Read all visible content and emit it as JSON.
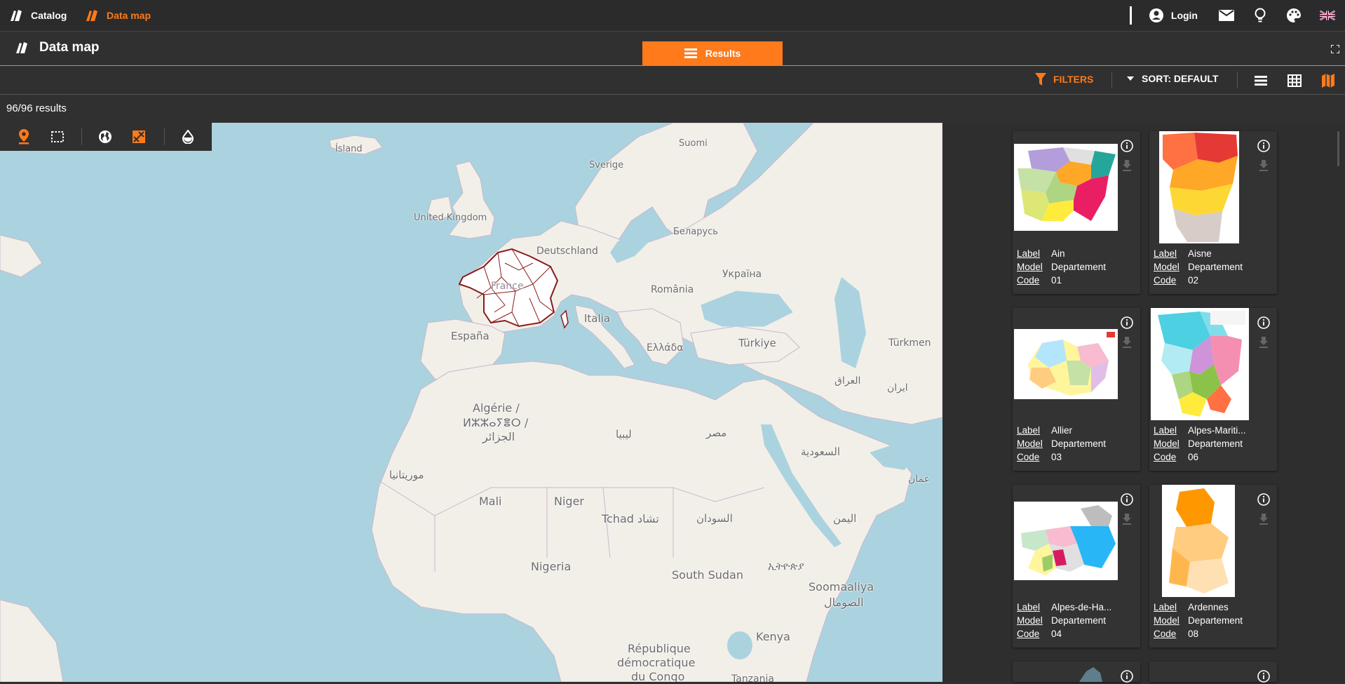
{
  "topbar": {
    "catalog_label": "Catalog",
    "datamap_label": "Data map",
    "login_label": "Login"
  },
  "header": {
    "page_title": "Data map",
    "results_tab_label": "Results"
  },
  "toolbar": {
    "filters_label": "FILTERS",
    "sort_label": "SORT: DEFAULT"
  },
  "results_count": "96/96 results",
  "colors": {
    "accent": "#ff7a1a",
    "background": "#303030",
    "sea": "#aad3df",
    "land": "#f2efe9"
  },
  "map": {
    "labels": [
      "Ísland",
      "Suomi",
      "Sverige",
      "United Kingdom",
      "Беларусь",
      "Deutschland",
      "Україна",
      "France",
      "România",
      "Italia",
      "España",
      "Türkiye",
      "Ελλάδα",
      "Türkmen",
      "العراق",
      "ایران",
      "Algérie /",
      "ⵍⵣⵣⴰⵢⴻⵔ /",
      "الجزائر",
      "ليبيا",
      "مصر",
      "السعودية",
      "موريتانيا",
      "Mali",
      "Niger",
      "Tchad تشاد",
      "السودان",
      "اليمن",
      "عمان",
      "Nigeria",
      "South Sudan",
      "ኢትዮጵያ",
      "Soomaaliya",
      "الصومال",
      "Kenya",
      "République",
      "démocratique",
      "du Congo",
      "Tanzania"
    ]
  },
  "cards": [
    {
      "label_key": "Label",
      "model_key": "Model",
      "code_key": "Code",
      "label": "Ain",
      "model": "Departement",
      "code": "01"
    },
    {
      "label_key": "Label",
      "model_key": "Model",
      "code_key": "Code",
      "label": "Aisne",
      "model": "Departement",
      "code": "02"
    },
    {
      "label_key": "Label",
      "model_key": "Model",
      "code_key": "Code",
      "label": "Allier",
      "model": "Departement",
      "code": "03"
    },
    {
      "label_key": "Label",
      "model_key": "Model",
      "code_key": "Code",
      "label": "Alpes-Mariti...",
      "model": "Departement",
      "code": "06"
    },
    {
      "label_key": "Label",
      "model_key": "Model",
      "code_key": "Code",
      "label": "Alpes-de-Ha...",
      "model": "Departement",
      "code": "04"
    },
    {
      "label_key": "Label",
      "model_key": "Model",
      "code_key": "Code",
      "label": "Ardennes",
      "model": "Departement",
      "code": "08"
    }
  ]
}
